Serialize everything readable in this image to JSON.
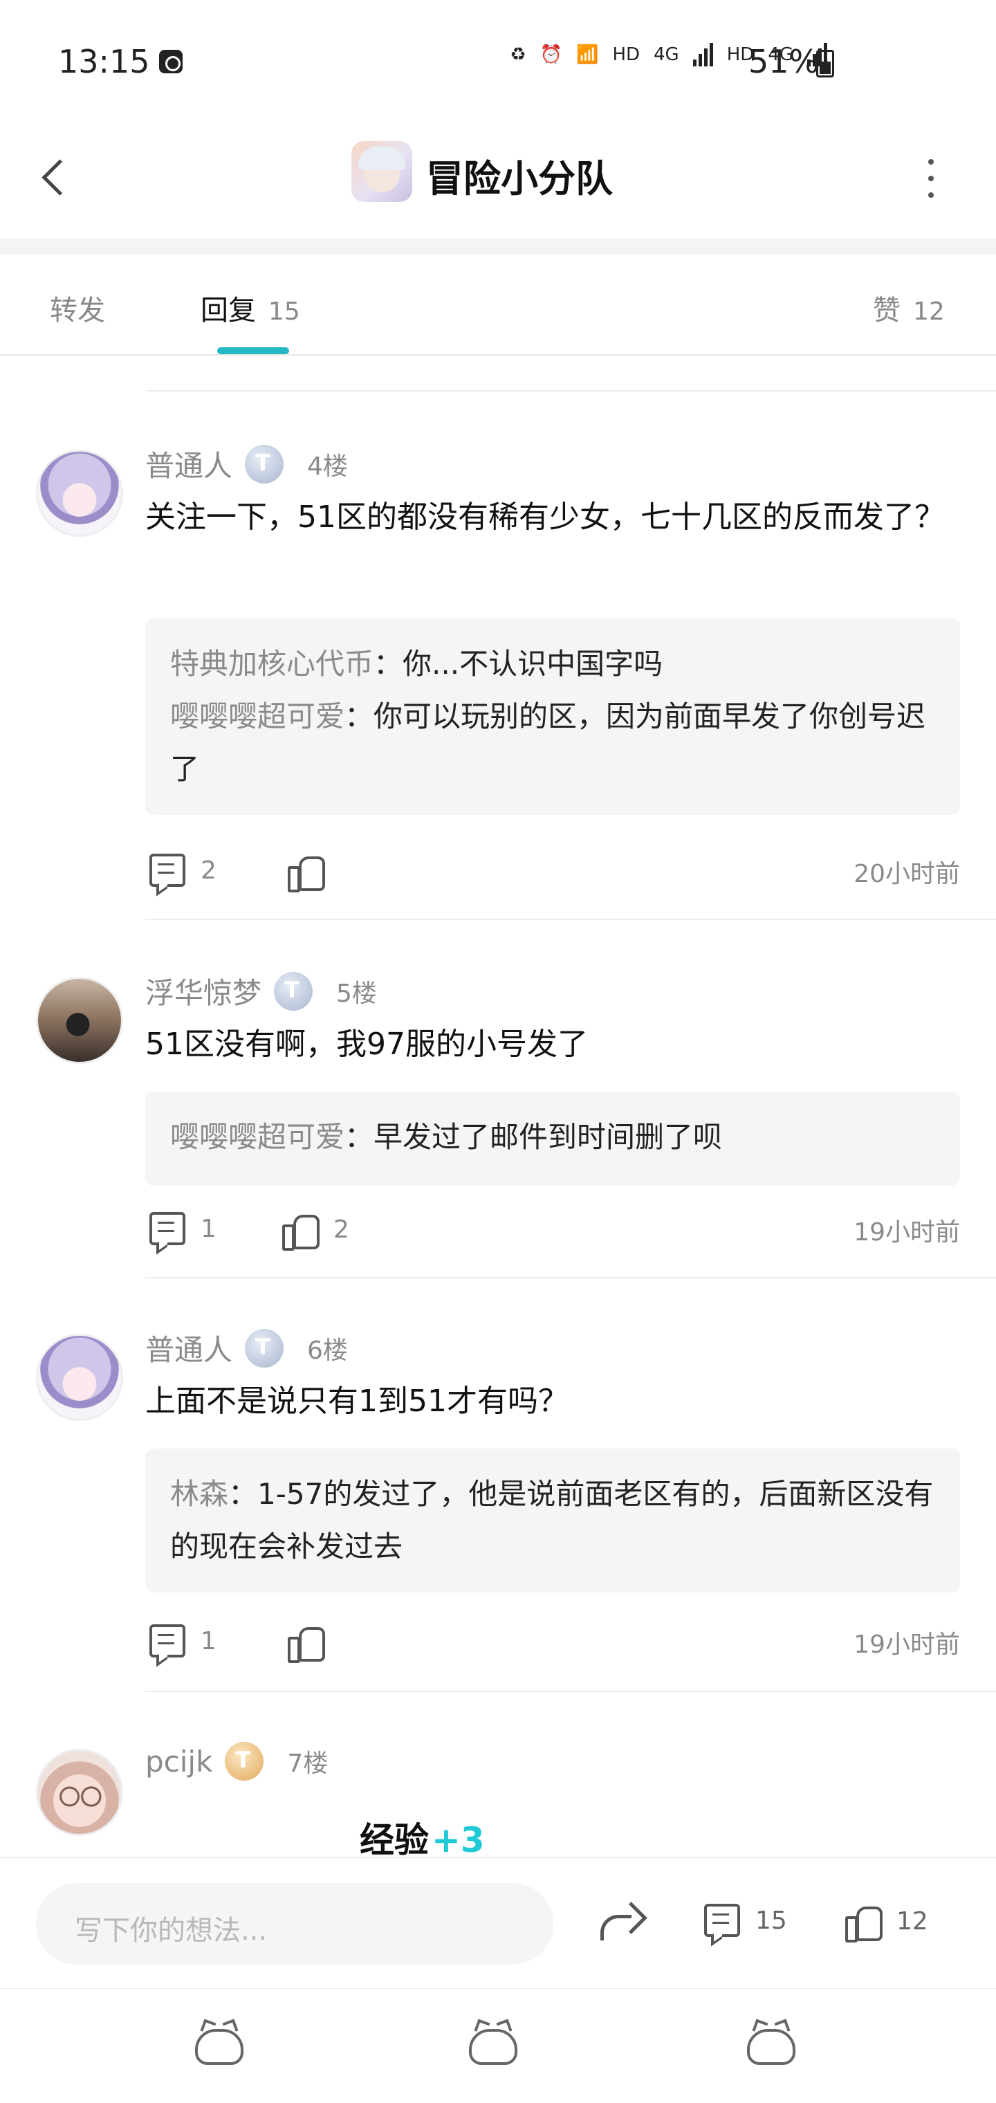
{
  "status_bar": {
    "time": "13:15",
    "network_labels": [
      "HD",
      "4G",
      "HD",
      "4G"
    ],
    "battery": "51%"
  },
  "header": {
    "title": "冒险小分队",
    "back_icon": "chevron-left-icon",
    "more_icon": "more-vertical-icon"
  },
  "tabs": {
    "forward_label": "转发",
    "reply_label": "回复",
    "reply_count": "15",
    "like_label": "赞",
    "like_count": "12"
  },
  "comments": [
    {
      "name": "普通人",
      "floor": "4楼",
      "text": "关注一下，51区的都没有稀有少女，七十几区的反而发了？",
      "replies": [
        {
          "who": "特典加核心代币",
          "sep": "：",
          "text": "你...不认识中国字吗"
        },
        {
          "who": "嘤嘤嘤超可爱",
          "sep": "：",
          "text": "你可以玩别的区，因为前面早发了你创号迟了"
        }
      ],
      "comment_count": "2",
      "like_count": "",
      "time": "20小时前"
    },
    {
      "name": "浮华惊梦",
      "floor": "5楼",
      "text": "51区没有啊，我97服的小号发了",
      "replies": [
        {
          "who": "嘤嘤嘤超可爱",
          "sep": "：",
          "text": "早发过了邮件到时间删了呗"
        }
      ],
      "comment_count": "1",
      "like_count": "2",
      "time": "19小时前"
    },
    {
      "name": "普通人",
      "floor": "6楼",
      "text": "上面不是说只有1到51才有吗？",
      "replies": [
        {
          "who": "林森",
          "sep": "：",
          "text": "1-57的发过了，他是说前面老区有的，后面新区没有的现在会补发过去"
        }
      ],
      "comment_count": "1",
      "like_count": "",
      "time": "19小时前"
    },
    {
      "name": "pcijk",
      "floor": "7楼"
    }
  ],
  "exp_badge": {
    "label": "经验",
    "value": "+3"
  },
  "input_bar": {
    "placeholder": "写下你的想法...",
    "comment_count": "15",
    "like_count": "12"
  },
  "bottom_nav": [
    "cat-sleeping-icon",
    "cat-curled-icon",
    "cat-sitting-icon"
  ]
}
